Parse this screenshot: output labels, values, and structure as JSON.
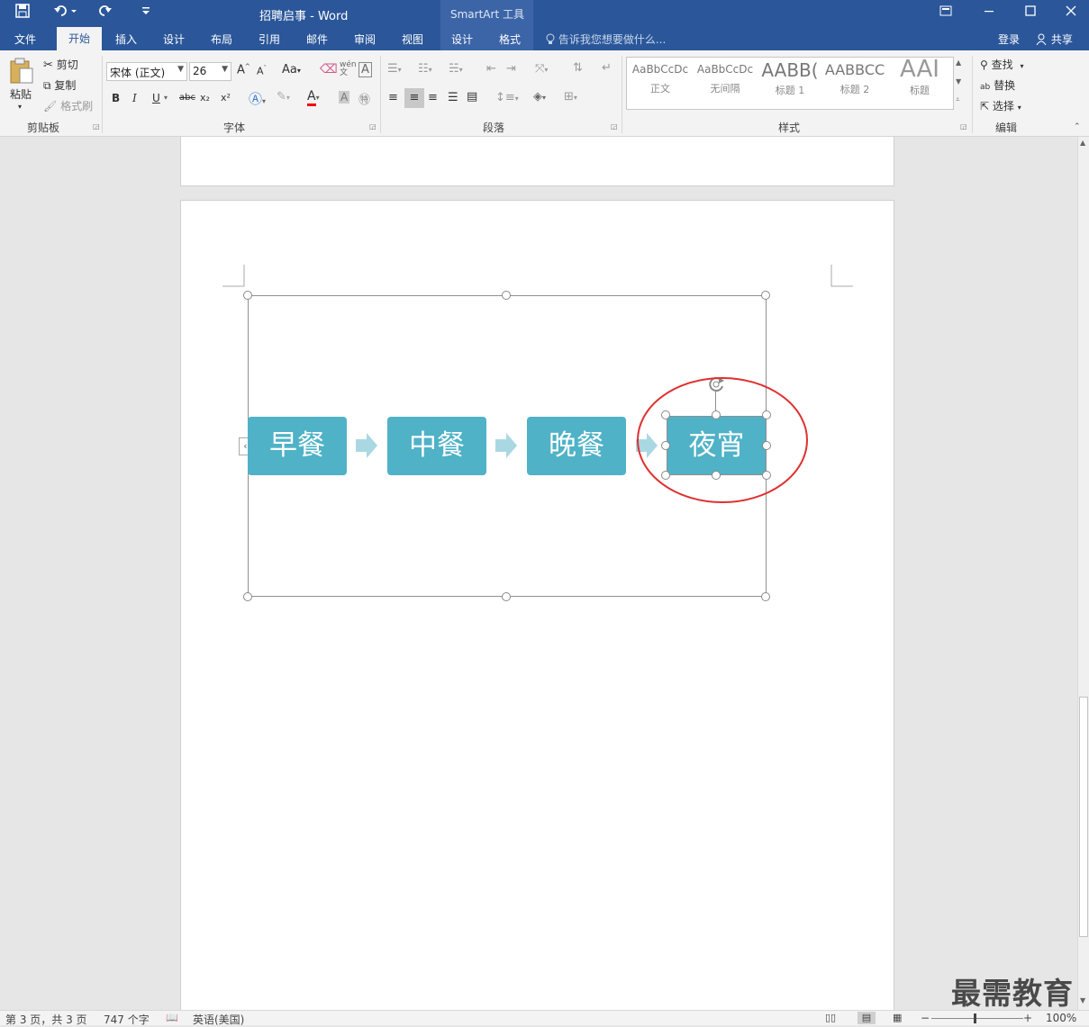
{
  "window": {
    "title": "招聘启事 - Word",
    "contextual_tab_group": "SmartArt 工具",
    "controls": [
      "ribbon-display-icon",
      "minimize-icon",
      "maximize-icon",
      "close-icon"
    ]
  },
  "quick_access": [
    "save-icon",
    "undo-icon",
    "redo-icon",
    "customize-icon"
  ],
  "tabs": {
    "file": "文件",
    "home": "开始",
    "insert": "插入",
    "design": "设计",
    "layout": "布局",
    "references": "引用",
    "mailings": "邮件",
    "review": "审阅",
    "view": "视图",
    "sa_design": "设计",
    "sa_format": "格式"
  },
  "tell_me": "告诉我您想要做什么...",
  "account": {
    "signin": "登录",
    "share": "共享"
  },
  "clipboard": {
    "paste": "粘贴",
    "cut": "剪切",
    "copy": "复制",
    "format_painter": "格式刷",
    "label": "剪贴板"
  },
  "font": {
    "name": "宋体 (正文)",
    "size": "26",
    "label": "字体",
    "change_case": "Aa",
    "bold": "B",
    "italic": "I",
    "underline": "U",
    "strike": "abc",
    "subscript": "x₂",
    "superscript": "x²"
  },
  "paragraph": {
    "label": "段落"
  },
  "styles": {
    "label": "样式",
    "items": [
      {
        "preview": "AaBbCcDc",
        "name": "正文"
      },
      {
        "preview": "AaBbCcDc",
        "name": "无间隔"
      },
      {
        "preview": "AABB(",
        "name": "标题 1"
      },
      {
        "preview": "AABBCC",
        "name": "标题 2"
      },
      {
        "preview": "AAI",
        "name": "标题"
      }
    ]
  },
  "editing": {
    "find": "查找",
    "replace": "替换",
    "select": "选择",
    "label": "编辑"
  },
  "smartart": {
    "nodes": [
      "早餐",
      "中餐",
      "晚餐",
      "夜宵"
    ],
    "selected_node": "夜宵",
    "box_color": "#4fb2c7",
    "arrow_color": "#a9d8e3",
    "highlight_color": "#e03030"
  },
  "status": {
    "page": "第 3 页，共 3 页",
    "words": "747 个字",
    "language": "英语(美国)",
    "zoom": "100%"
  },
  "watermark": "最需教育"
}
